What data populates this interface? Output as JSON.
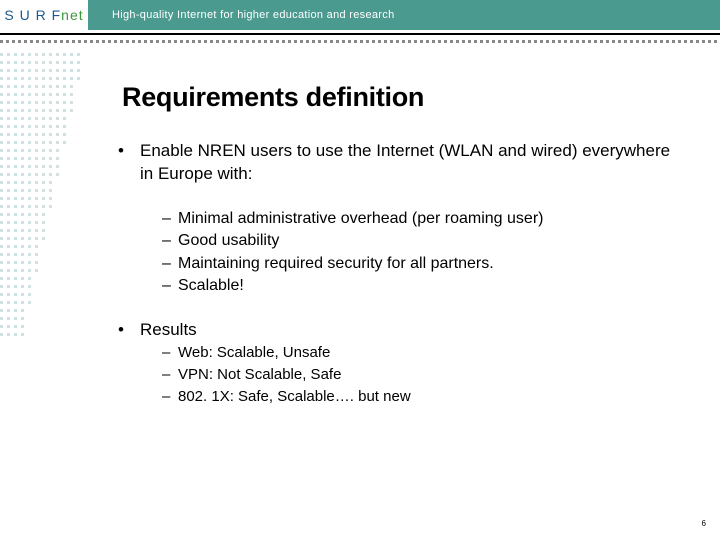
{
  "header": {
    "logo_letters": "S U R F",
    "logo_net": "net",
    "tagline": "High-quality Internet for higher education and research"
  },
  "title": "Requirements definition",
  "bullets": [
    {
      "text": "Enable NREN users to use the Internet (WLAN and wired) everywhere in Europe with:",
      "sub": [
        "Minimal administrative overhead (per roaming user)",
        "Good usability",
        "Maintaining required security for all partners.",
        "Scalable!"
      ]
    },
    {
      "text": "Results",
      "sub": [
        "Web: Scalable, Unsafe",
        "VPN: Not Scalable, Safe",
        "802. 1X: Safe, Scalable…. but new"
      ]
    }
  ],
  "page_number": "6"
}
